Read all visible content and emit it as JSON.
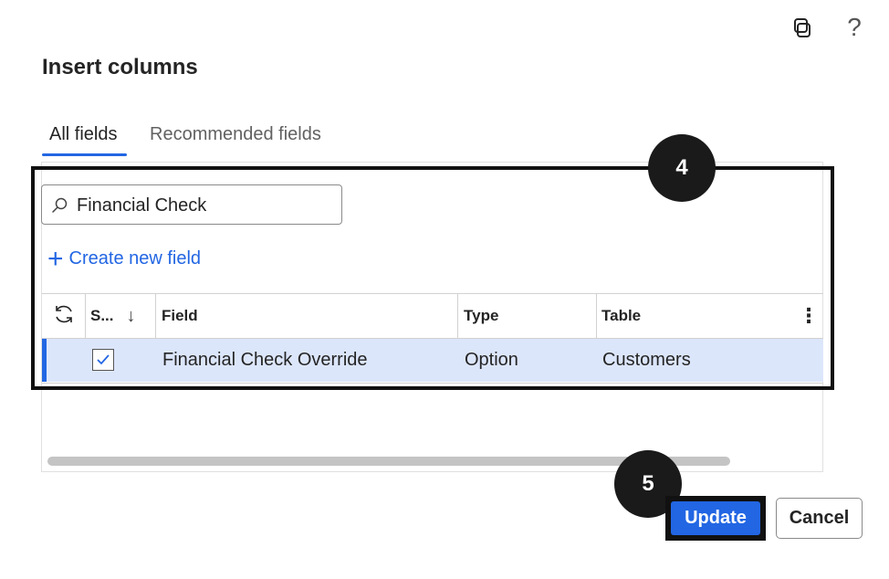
{
  "dialog": {
    "title": "Insert columns",
    "help_glyph": "?"
  },
  "tabs": [
    {
      "label": "All fields",
      "selected": true
    },
    {
      "label": "Recommended fields",
      "selected": false
    }
  ],
  "search": {
    "value": "Financial Check",
    "icon": "search-icon"
  },
  "create_new": {
    "plus_glyph": "+",
    "label": "Create new field"
  },
  "grid": {
    "columns": {
      "selected": "S...",
      "sort_glyph": "↓",
      "field": "Field",
      "type": "Type",
      "table": "Table",
      "more_glyph": "⋮"
    },
    "rows": [
      {
        "selected": true,
        "field": "Financial Check Override",
        "type": "Option",
        "table": "Customers"
      }
    ]
  },
  "callouts": {
    "step_4": "4",
    "step_5": "5"
  },
  "buttons": {
    "update": "Update",
    "cancel": "Cancel"
  },
  "colors": {
    "accent": "#2266e3",
    "selected_row": "#dce6fb",
    "callout": "#111111"
  }
}
